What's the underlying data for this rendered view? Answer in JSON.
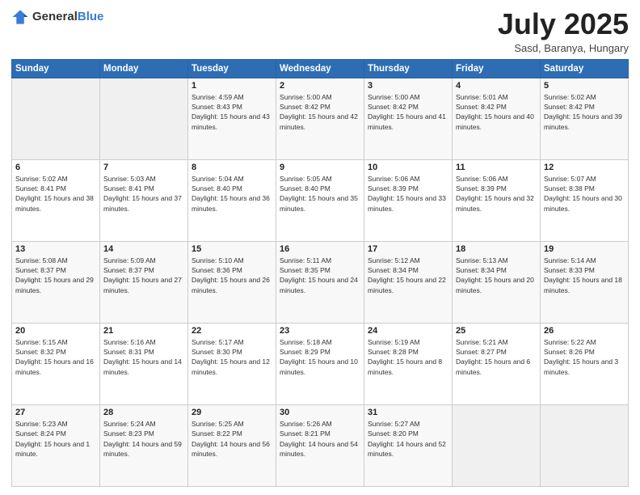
{
  "header": {
    "logo": {
      "general": "General",
      "blue": "Blue"
    },
    "title": "July 2025",
    "location": "Sasd, Baranya, Hungary"
  },
  "weekdays": [
    "Sunday",
    "Monday",
    "Tuesday",
    "Wednesday",
    "Thursday",
    "Friday",
    "Saturday"
  ],
  "weeks": [
    [
      {
        "day": "",
        "sunrise": "",
        "sunset": "",
        "daylight": ""
      },
      {
        "day": "",
        "sunrise": "",
        "sunset": "",
        "daylight": ""
      },
      {
        "day": "1",
        "sunrise": "Sunrise: 4:59 AM",
        "sunset": "Sunset: 8:43 PM",
        "daylight": "Daylight: 15 hours and 43 minutes."
      },
      {
        "day": "2",
        "sunrise": "Sunrise: 5:00 AM",
        "sunset": "Sunset: 8:42 PM",
        "daylight": "Daylight: 15 hours and 42 minutes."
      },
      {
        "day": "3",
        "sunrise": "Sunrise: 5:00 AM",
        "sunset": "Sunset: 8:42 PM",
        "daylight": "Daylight: 15 hours and 41 minutes."
      },
      {
        "day": "4",
        "sunrise": "Sunrise: 5:01 AM",
        "sunset": "Sunset: 8:42 PM",
        "daylight": "Daylight: 15 hours and 40 minutes."
      },
      {
        "day": "5",
        "sunrise": "Sunrise: 5:02 AM",
        "sunset": "Sunset: 8:42 PM",
        "daylight": "Daylight: 15 hours and 39 minutes."
      }
    ],
    [
      {
        "day": "6",
        "sunrise": "Sunrise: 5:02 AM",
        "sunset": "Sunset: 8:41 PM",
        "daylight": "Daylight: 15 hours and 38 minutes."
      },
      {
        "day": "7",
        "sunrise": "Sunrise: 5:03 AM",
        "sunset": "Sunset: 8:41 PM",
        "daylight": "Daylight: 15 hours and 37 minutes."
      },
      {
        "day": "8",
        "sunrise": "Sunrise: 5:04 AM",
        "sunset": "Sunset: 8:40 PM",
        "daylight": "Daylight: 15 hours and 36 minutes."
      },
      {
        "day": "9",
        "sunrise": "Sunrise: 5:05 AM",
        "sunset": "Sunset: 8:40 PM",
        "daylight": "Daylight: 15 hours and 35 minutes."
      },
      {
        "day": "10",
        "sunrise": "Sunrise: 5:06 AM",
        "sunset": "Sunset: 8:39 PM",
        "daylight": "Daylight: 15 hours and 33 minutes."
      },
      {
        "day": "11",
        "sunrise": "Sunrise: 5:06 AM",
        "sunset": "Sunset: 8:39 PM",
        "daylight": "Daylight: 15 hours and 32 minutes."
      },
      {
        "day": "12",
        "sunrise": "Sunrise: 5:07 AM",
        "sunset": "Sunset: 8:38 PM",
        "daylight": "Daylight: 15 hours and 30 minutes."
      }
    ],
    [
      {
        "day": "13",
        "sunrise": "Sunrise: 5:08 AM",
        "sunset": "Sunset: 8:37 PM",
        "daylight": "Daylight: 15 hours and 29 minutes."
      },
      {
        "day": "14",
        "sunrise": "Sunrise: 5:09 AM",
        "sunset": "Sunset: 8:37 PM",
        "daylight": "Daylight: 15 hours and 27 minutes."
      },
      {
        "day": "15",
        "sunrise": "Sunrise: 5:10 AM",
        "sunset": "Sunset: 8:36 PM",
        "daylight": "Daylight: 15 hours and 26 minutes."
      },
      {
        "day": "16",
        "sunrise": "Sunrise: 5:11 AM",
        "sunset": "Sunset: 8:35 PM",
        "daylight": "Daylight: 15 hours and 24 minutes."
      },
      {
        "day": "17",
        "sunrise": "Sunrise: 5:12 AM",
        "sunset": "Sunset: 8:34 PM",
        "daylight": "Daylight: 15 hours and 22 minutes."
      },
      {
        "day": "18",
        "sunrise": "Sunrise: 5:13 AM",
        "sunset": "Sunset: 8:34 PM",
        "daylight": "Daylight: 15 hours and 20 minutes."
      },
      {
        "day": "19",
        "sunrise": "Sunrise: 5:14 AM",
        "sunset": "Sunset: 8:33 PM",
        "daylight": "Daylight: 15 hours and 18 minutes."
      }
    ],
    [
      {
        "day": "20",
        "sunrise": "Sunrise: 5:15 AM",
        "sunset": "Sunset: 8:32 PM",
        "daylight": "Daylight: 15 hours and 16 minutes."
      },
      {
        "day": "21",
        "sunrise": "Sunrise: 5:16 AM",
        "sunset": "Sunset: 8:31 PM",
        "daylight": "Daylight: 15 hours and 14 minutes."
      },
      {
        "day": "22",
        "sunrise": "Sunrise: 5:17 AM",
        "sunset": "Sunset: 8:30 PM",
        "daylight": "Daylight: 15 hours and 12 minutes."
      },
      {
        "day": "23",
        "sunrise": "Sunrise: 5:18 AM",
        "sunset": "Sunset: 8:29 PM",
        "daylight": "Daylight: 15 hours and 10 minutes."
      },
      {
        "day": "24",
        "sunrise": "Sunrise: 5:19 AM",
        "sunset": "Sunset: 8:28 PM",
        "daylight": "Daylight: 15 hours and 8 minutes."
      },
      {
        "day": "25",
        "sunrise": "Sunrise: 5:21 AM",
        "sunset": "Sunset: 8:27 PM",
        "daylight": "Daylight: 15 hours and 6 minutes."
      },
      {
        "day": "26",
        "sunrise": "Sunrise: 5:22 AM",
        "sunset": "Sunset: 8:26 PM",
        "daylight": "Daylight: 15 hours and 3 minutes."
      }
    ],
    [
      {
        "day": "27",
        "sunrise": "Sunrise: 5:23 AM",
        "sunset": "Sunset: 8:24 PM",
        "daylight": "Daylight: 15 hours and 1 minute."
      },
      {
        "day": "28",
        "sunrise": "Sunrise: 5:24 AM",
        "sunset": "Sunset: 8:23 PM",
        "daylight": "Daylight: 14 hours and 59 minutes."
      },
      {
        "day": "29",
        "sunrise": "Sunrise: 5:25 AM",
        "sunset": "Sunset: 8:22 PM",
        "daylight": "Daylight: 14 hours and 56 minutes."
      },
      {
        "day": "30",
        "sunrise": "Sunrise: 5:26 AM",
        "sunset": "Sunset: 8:21 PM",
        "daylight": "Daylight: 14 hours and 54 minutes."
      },
      {
        "day": "31",
        "sunrise": "Sunrise: 5:27 AM",
        "sunset": "Sunset: 8:20 PM",
        "daylight": "Daylight: 14 hours and 52 minutes."
      },
      {
        "day": "",
        "sunrise": "",
        "sunset": "",
        "daylight": ""
      },
      {
        "day": "",
        "sunrise": "",
        "sunset": "",
        "daylight": ""
      }
    ]
  ]
}
